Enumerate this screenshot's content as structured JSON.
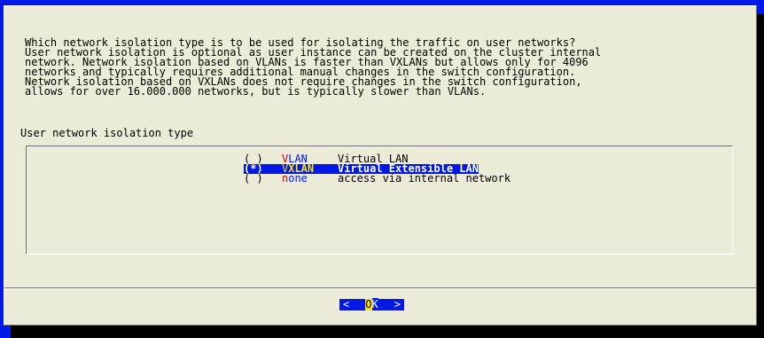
{
  "dialog": {
    "description_lines": [
      "Which network isolation type is to be used for isolating the traffic on user networks?",
      "User network isolation is optional as user instance can be created on the cluster internal",
      "network. Network isolation based on VLANs is faster than VXLANs but allows only for 4096",
      "networks and typically requires additional manual changes in the switch configuration.",
      "Network isolation based on VXLANs does not require changes in the switch configuration,",
      "allows for over 16.000.000 networks, but is typically slower than VLANs."
    ],
    "list_label": "User network isolation type",
    "options": [
      {
        "mark": "( )",
        "hotkey": "V",
        "tag_rest": "LAN",
        "description": "Virtual LAN",
        "selected": false
      },
      {
        "mark": "(*)",
        "hotkey": "V",
        "tag_rest": "XLAN",
        "description": "Virtual Extensible LAN",
        "selected": true
      },
      {
        "mark": "( )",
        "hotkey": "n",
        "tag_rest": "one",
        "description": "access via internal network",
        "selected": false
      }
    ],
    "ok_button": {
      "left": "<",
      "hot": "O",
      "rest": "K",
      "right": ">"
    }
  },
  "colors": {
    "background": "#0018e8",
    "dialog": "#ecebd7",
    "hotkey": "#d40000",
    "highlight": "#0018e8",
    "selected_hotkey": "#ffe400"
  }
}
